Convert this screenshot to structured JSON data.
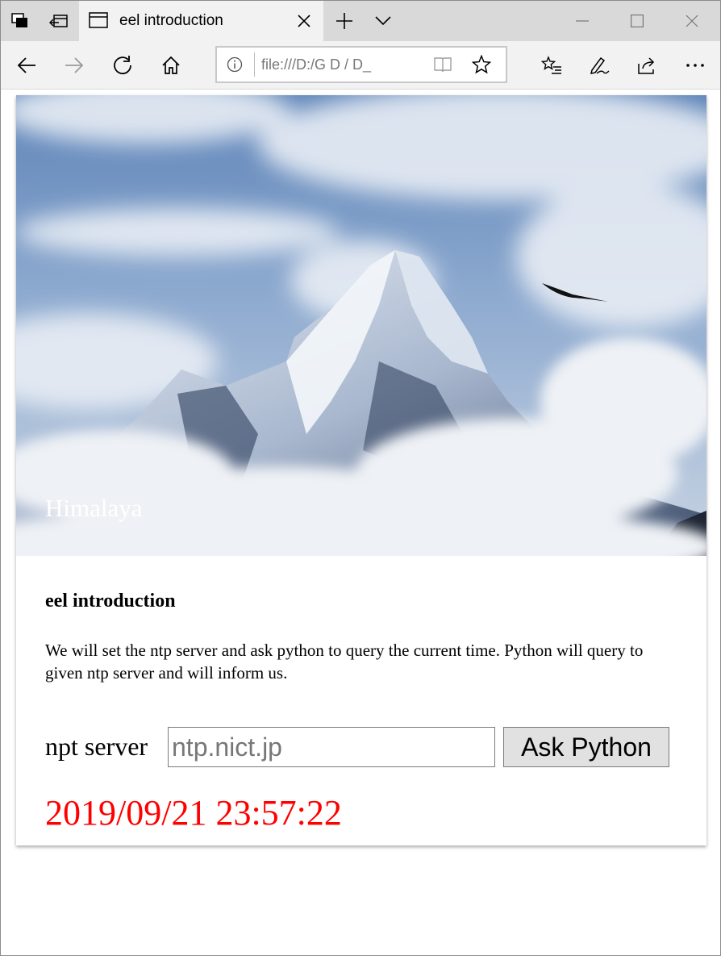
{
  "browser": {
    "tab_title": "eel introduction",
    "address": "file:///D:/G  D    /  D_"
  },
  "page": {
    "hero_caption": "Himalaya",
    "heading": "eel introduction",
    "description": "We will set the ntp server and ask python to query the current time. Python will query to given ntp server and will inform us.",
    "form": {
      "label": "npt server",
      "input_value": "",
      "input_placeholder": "ntp.nict.jp",
      "button_label": "Ask Python"
    },
    "result_time": "2019/09/21 23:57:22"
  },
  "colors": {
    "result_text": "#ff0000",
    "tab_strip": "#d9d9d9",
    "active_tab": "#f2f2f2"
  },
  "icons": [
    "tab-actions-icon",
    "tabs-aside-icon",
    "tab-page-icon",
    "close-icon",
    "new-tab-icon",
    "chevron-down-icon",
    "minimize-icon",
    "maximize-icon",
    "window-close-icon",
    "back-icon",
    "forward-icon",
    "refresh-icon",
    "home-icon",
    "info-icon",
    "reading-view-icon",
    "favorite-star-icon",
    "favorites-list-icon",
    "pen-icon",
    "share-icon",
    "more-icon"
  ]
}
